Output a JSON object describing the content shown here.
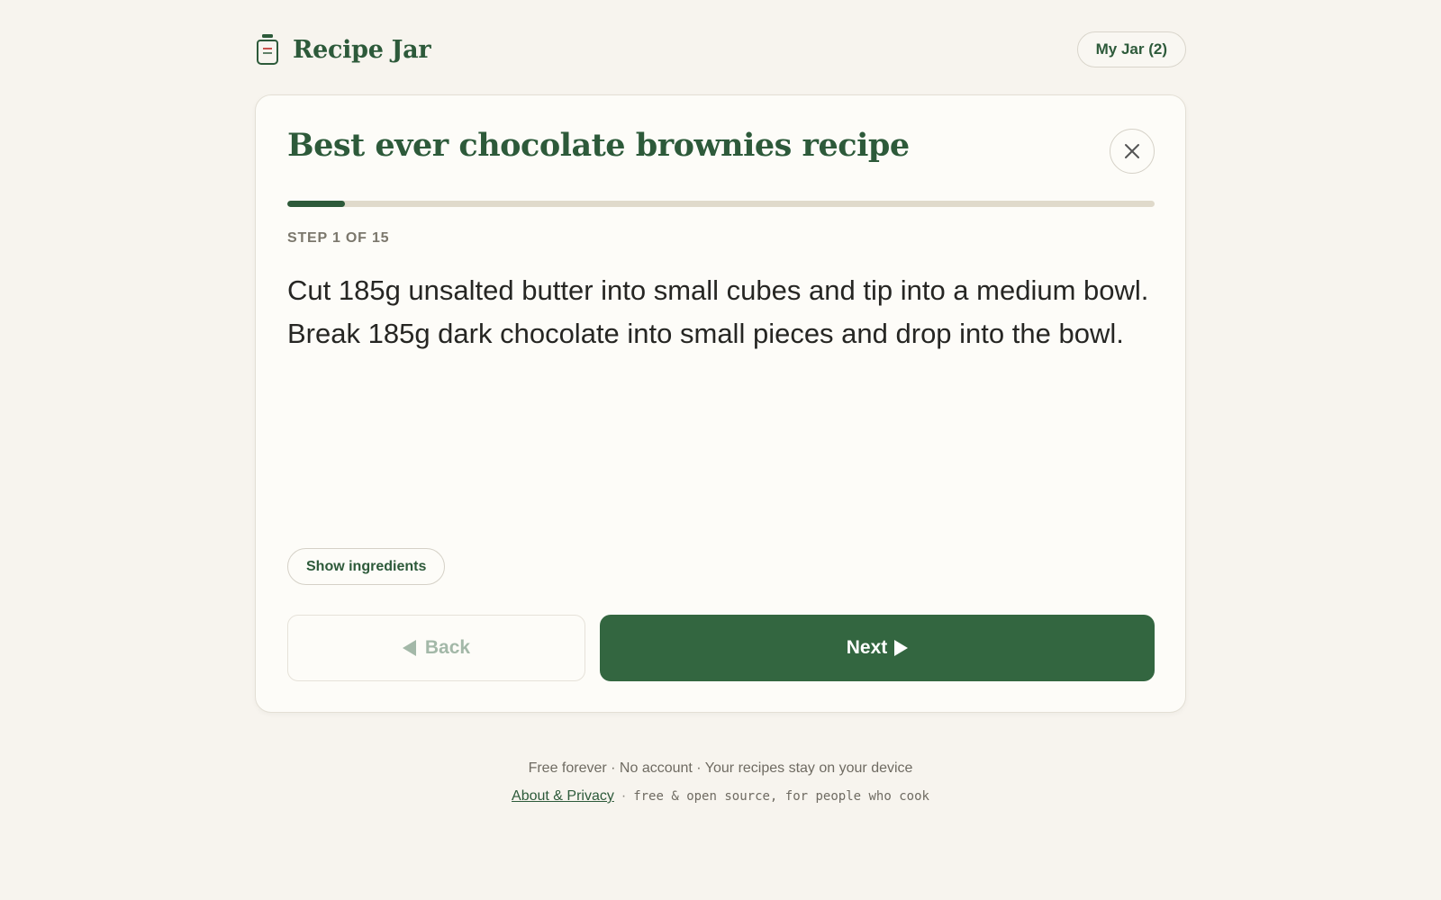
{
  "header": {
    "brand": "Recipe Jar",
    "jar_button": "My Jar (2)"
  },
  "recipe": {
    "title": "Best ever chocolate brownies recipe",
    "step_label": "STEP 1 OF 15",
    "current_step": 1,
    "total_steps": 15,
    "progress_fraction": 0.0667,
    "step_text": "Cut 185g unsalted butter into small cubes and tip into a medium bowl. Break 185g dark chocolate into small pieces and drop into the bowl."
  },
  "controls": {
    "show_ingredients": "Show ingredients",
    "back": "Back",
    "next": "Next"
  },
  "footer": {
    "tagline": "Free forever · No account · Your recipes stay on your device",
    "about_link": "About & Privacy",
    "separator": "·",
    "note": "free & open source, for people who cook"
  },
  "colors": {
    "accent": "#336640",
    "background": "#f7f4ee",
    "card": "#fdfcf8",
    "progress_track": "#e0dacb"
  },
  "icons": {
    "brand": "jar-icon",
    "close": "close-icon",
    "back": "triangle-left-icon",
    "next": "triangle-right-icon"
  }
}
